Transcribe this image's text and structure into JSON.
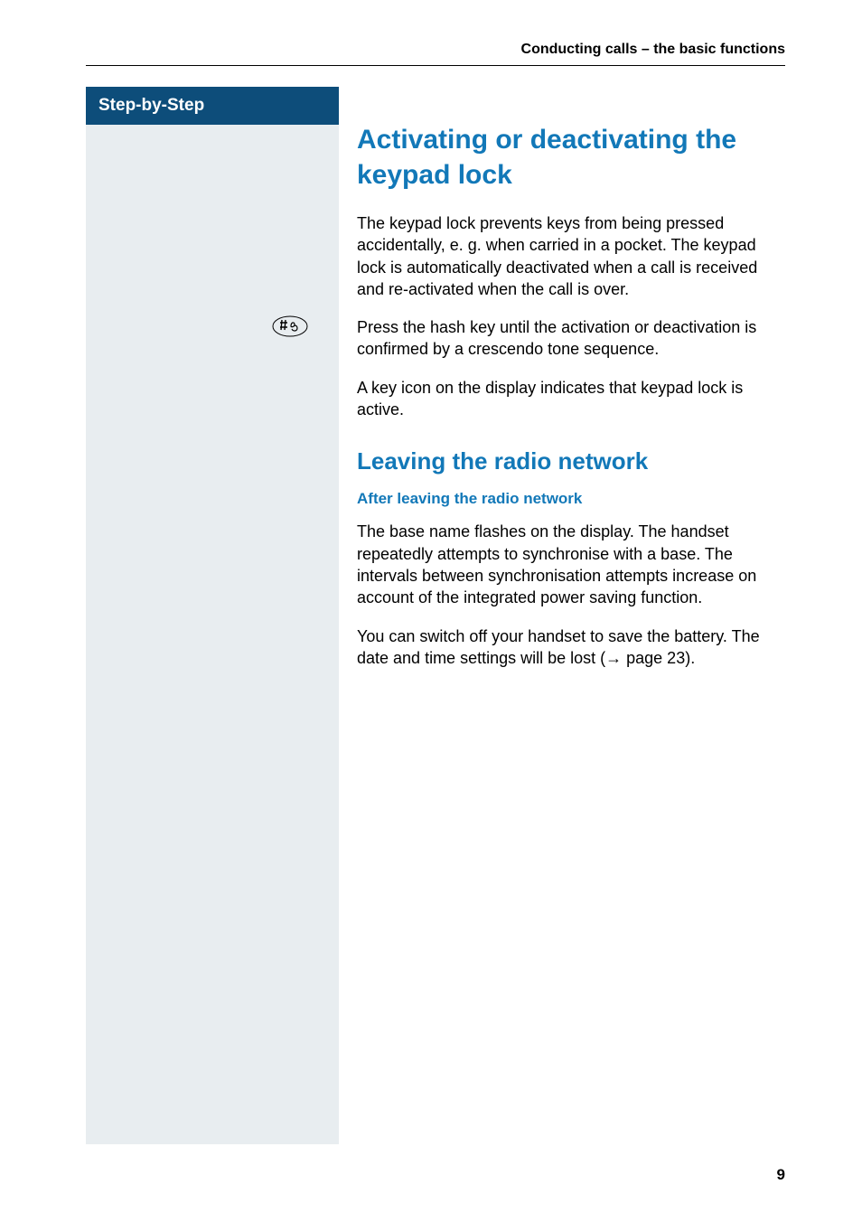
{
  "header": {
    "running_title": "Conducting calls – the basic functions"
  },
  "sidebar": {
    "badge": "Step-by-Step"
  },
  "content": {
    "section1": {
      "title": "Activating or deactivating the keypad lock",
      "para1": "The keypad lock prevents keys from being pressed accidentally, e. g. when carried in a pocket. The keypad lock is automatically deactivated when a call is received and re-activated when the call is over.",
      "step_icon": "hash-key-icon",
      "step_text": "Press the hash key until the activation or deactivation is confirmed by a crescendo tone sequence.",
      "para2": "A key icon on the display indicates that keypad lock is active."
    },
    "section2": {
      "title": "Leaving the radio network",
      "subtitle": "After leaving the radio network",
      "para1": "The base name flashes on the display. The handset repeatedly attempts to synchronise with a base. The intervals between synchronisation attempts increase on account of the integrated power saving function.",
      "para2_a": "You can switch off your handset to save the battery. The date and time settings will be lost (",
      "para2_b": " page 23)."
    }
  },
  "page_number": "9"
}
